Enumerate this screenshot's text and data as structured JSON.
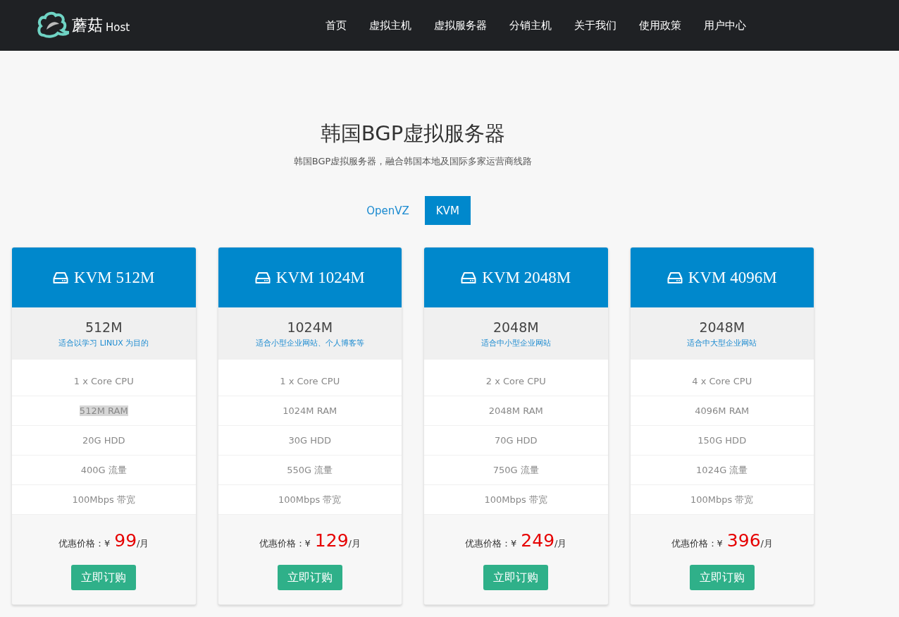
{
  "brand": {
    "name": "蘑菇",
    "suffix": "Host"
  },
  "nav": [
    "首页",
    "虚拟主机",
    "虚拟服务器",
    "分销主机",
    "关于我们",
    "使用政策",
    "用户中心"
  ],
  "heading": "韩国BGP虚拟服务器",
  "subheading": "韩国BGP虚拟服务器，融合韩国本地及国际多家运营商线路",
  "tabs": [
    {
      "label": "OpenVZ",
      "selected": false
    },
    {
      "label": "KVM",
      "selected": true
    }
  ],
  "plans": [
    {
      "title": "KVM 512M",
      "size": "512M",
      "tagline": "适合以学习 LINUX 为目的",
      "features": [
        {
          "text": "1 x Core CPU",
          "highlighted": false
        },
        {
          "text": "512M RAM",
          "highlighted": true
        },
        {
          "text": "20G HDD",
          "highlighted": false
        },
        {
          "text": "400G 流量",
          "highlighted": false
        },
        {
          "text": "100Mbps 带宽",
          "highlighted": false
        }
      ],
      "price_label": "优惠价格：¥",
      "price": "99",
      "unit": "/月",
      "button": "立即订购"
    },
    {
      "title": "KVM 1024M",
      "size": "1024M",
      "tagline": "适合小型企业网站、个人博客等",
      "features": [
        {
          "text": "1 x Core CPU",
          "highlighted": false
        },
        {
          "text": "1024M RAM",
          "highlighted": false
        },
        {
          "text": "30G HDD",
          "highlighted": false
        },
        {
          "text": "550G 流量",
          "highlighted": false
        },
        {
          "text": "100Mbps 带宽",
          "highlighted": false
        }
      ],
      "price_label": "优惠价格：¥",
      "price": "129",
      "unit": "/月",
      "button": "立即订购"
    },
    {
      "title": "KVM 2048M",
      "size": "2048M",
      "tagline": "适合中小型企业网站",
      "features": [
        {
          "text": "2 x Core CPU",
          "highlighted": false
        },
        {
          "text": "2048M RAM",
          "highlighted": false
        },
        {
          "text": "70G HDD",
          "highlighted": false
        },
        {
          "text": "750G 流量",
          "highlighted": false
        },
        {
          "text": "100Mbps 带宽",
          "highlighted": false
        }
      ],
      "price_label": "优惠价格：¥",
      "price": "249",
      "unit": "/月",
      "button": "立即订购"
    },
    {
      "title": "KVM 4096M",
      "size": "2048M",
      "tagline": "适合中大型企业网站",
      "features": [
        {
          "text": "4 x Core CPU",
          "highlighted": false
        },
        {
          "text": "4096M RAM",
          "highlighted": false
        },
        {
          "text": "150G HDD",
          "highlighted": false
        },
        {
          "text": "1024G 流量",
          "highlighted": false
        },
        {
          "text": "100Mbps 带宽",
          "highlighted": false
        }
      ],
      "price_label": "优惠价格：¥",
      "price": "396",
      "unit": "/月",
      "button": "立即订购"
    }
  ]
}
